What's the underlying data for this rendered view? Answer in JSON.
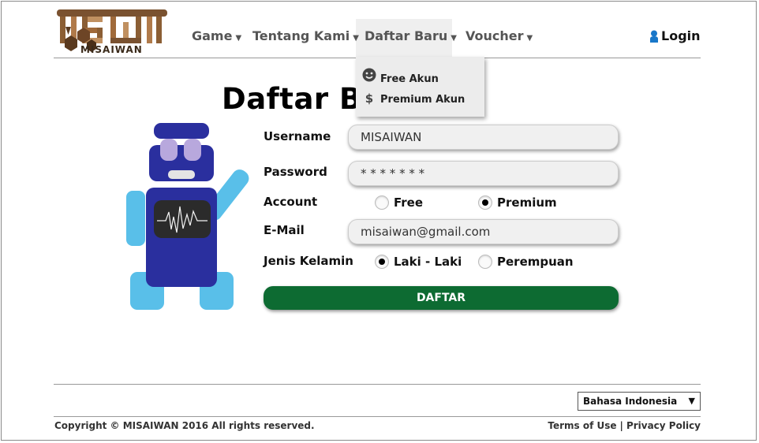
{
  "brand": {
    "logo_mark": "MSW",
    "logo_text": "MISAIWAN"
  },
  "nav": {
    "items": [
      {
        "label": "Game"
      },
      {
        "label": "Tentang Kami"
      },
      {
        "label": "Daftar Baru"
      },
      {
        "label": "Voucher"
      }
    ],
    "active_index": 2,
    "login_label": "Login"
  },
  "dropdown": {
    "items": [
      {
        "label": "Free Akun",
        "icon": "smiley-icon"
      },
      {
        "label": "Premium Akun",
        "icon": "dollar-icon"
      }
    ]
  },
  "page": {
    "title": "Daftar Baru"
  },
  "form": {
    "username": {
      "label": "Username",
      "value": "MISAIWAN"
    },
    "password": {
      "label": "Password",
      "value": "* * * * * * *"
    },
    "account": {
      "label": "Account",
      "options": [
        {
          "label": "Free",
          "selected": false
        },
        {
          "label": "Premium",
          "selected": true
        }
      ]
    },
    "email": {
      "label": "E-Mail",
      "value": "misaiwan@gmail.com"
    },
    "gender": {
      "label": "Jenis Kelamin",
      "options": [
        {
          "label": "Laki - Laki",
          "selected": true
        },
        {
          "label": "Perempuan",
          "selected": false
        }
      ]
    },
    "submit_label": "DAFTAR"
  },
  "footer": {
    "language": "Bahasa Indonesia",
    "copyright": "Copyright © MISAIWAN 2016 All rights reserved.",
    "terms": "Terms of Use",
    "separator": "|",
    "privacy": "Privacy Policy"
  },
  "colors": {
    "brand_brown": "#8b5e34",
    "button_green": "#0d6b32",
    "robot_body": "#2a2f9e",
    "robot_limbs": "#59bfe9",
    "robot_eyes": "#b8a8dd"
  }
}
